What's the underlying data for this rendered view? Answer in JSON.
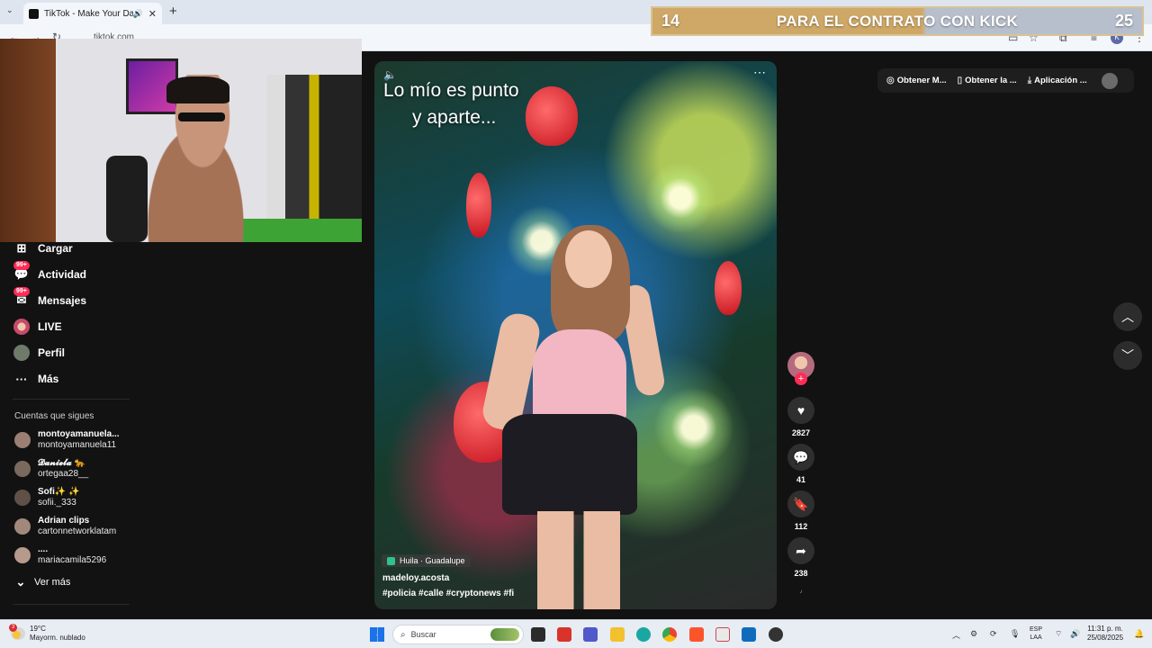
{
  "browser": {
    "tab_title": "TikTok - Make Your Day",
    "url": "tiktok.com"
  },
  "banner": {
    "left_number": "14",
    "text": "PARA EL CONTRATO CON KICK",
    "right_number": "25"
  },
  "sidebar": {
    "items": [
      {
        "label": "Cargar",
        "icon": "upload-icon"
      },
      {
        "label": "Actividad",
        "icon": "activity-icon",
        "badge": "99+"
      },
      {
        "label": "Mensajes",
        "icon": "messages-icon",
        "badge": "99+"
      },
      {
        "label": "LIVE",
        "icon": "live-icon"
      },
      {
        "label": "Perfil",
        "icon": "profile-avatar"
      },
      {
        "label": "Más",
        "icon": "more-icon"
      }
    ],
    "following_title": "Cuentas que sigues",
    "following": [
      {
        "name": "montoyamanuela...",
        "handle": "montoyamanuela11"
      },
      {
        "name": "𝓓𝓪𝓷𝓲𝓮𝓵𝓪 🐆",
        "handle": "ortegaa28__"
      },
      {
        "name": "Sofi✨ ✨",
        "handle": "sofii._333"
      },
      {
        "name": "Adrian clips",
        "handle": "cartonnetworklatam"
      },
      {
        "name": "....",
        "handle": "mariacamila5296"
      }
    ],
    "see_more": "Ver más"
  },
  "video": {
    "caption_line1": "Lo mío es punto",
    "caption_line2": "y aparte...",
    "location": "Huila · Guadalupe",
    "author": "madeloy.acosta",
    "tags": "#policia  #calle  #cryptonews  #fi"
  },
  "actions": {
    "likes": "2827",
    "comments": "41",
    "saves": "112",
    "shares": "238"
  },
  "top_chips": [
    {
      "label": "Obtener M...",
      "icon": "coin-icon"
    },
    {
      "label": "Obtener la ...",
      "icon": "phone-icon"
    },
    {
      "label": "Aplicación ...",
      "icon": "download-icon"
    }
  ],
  "taskbar": {
    "temperature": "19°C",
    "weather": "Mayorm. nublado",
    "weather_badge": "3",
    "search_placeholder": "Buscar",
    "lang_line1": "ESP",
    "lang_line2": "LAA",
    "time": "11:31 p. m.",
    "date": "25/08/2025"
  }
}
